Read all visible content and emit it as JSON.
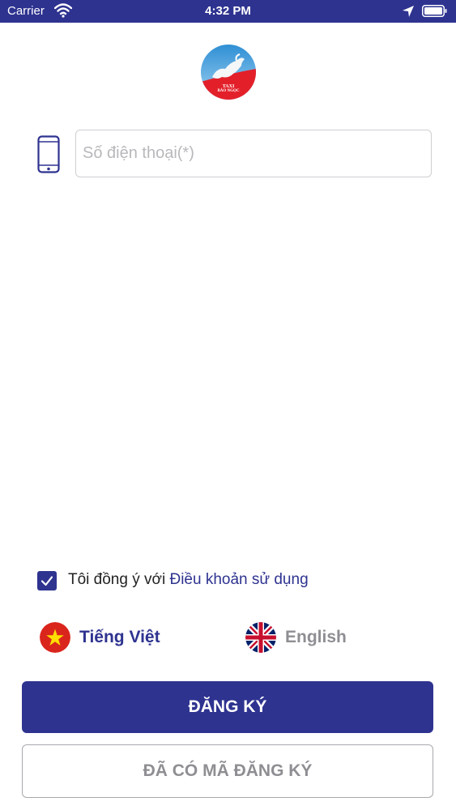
{
  "status_bar": {
    "carrier": "Carrier",
    "time": "4:32 PM",
    "icons": [
      "wifi-icon",
      "location-arrow-icon",
      "battery-icon"
    ]
  },
  "logo": {
    "line1": "TAXI",
    "line2": "BẢO NGỌC"
  },
  "form": {
    "phone_placeholder": "Số điện thoại(*)",
    "phone_value": ""
  },
  "terms": {
    "checked": true,
    "prefix": "Tôi đồng ý với ",
    "link": "Điều khoản sử dụng"
  },
  "languages": [
    {
      "label": "Tiếng Việt",
      "selected": true,
      "icon": "vietnam-flag-icon"
    },
    {
      "label": "English",
      "selected": false,
      "icon": "uk-flag-icon"
    }
  ],
  "buttons": {
    "register": "ĐĂNG KÝ",
    "have_code": "ĐÃ CÓ MÃ ĐĂNG KÝ"
  },
  "colors": {
    "primary": "#2e3390",
    "muted": "#8e8e93",
    "logo_red": "#e3202a",
    "logo_blue": "#4aa3de"
  }
}
